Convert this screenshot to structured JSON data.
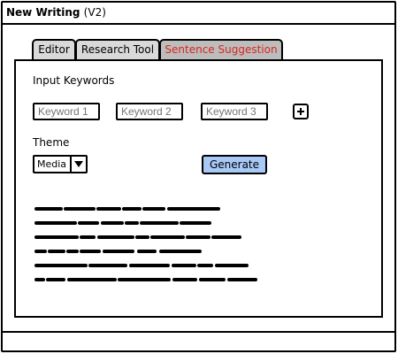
{
  "window": {
    "title": "New Writing",
    "version": "(V2)"
  },
  "tabs": [
    {
      "label": "Editor",
      "active": false
    },
    {
      "label": "Research Tool",
      "active": false
    },
    {
      "label": "Sentence Suggestion",
      "active": true
    }
  ],
  "form": {
    "input_keywords_label": "Input Keywords",
    "keyword_1_placeholder": "Keyword 1",
    "keyword_2_placeholder": "Keyword 2",
    "keyword_3_placeholder": "Keyword 3",
    "theme_label": "Theme",
    "theme_value": "Media",
    "generate_label": "Generate"
  },
  "colors": {
    "active_tab_text": "#d9261c",
    "generate_button": "#a8c8f5",
    "placeholder_text": "#bcbcbc"
  }
}
